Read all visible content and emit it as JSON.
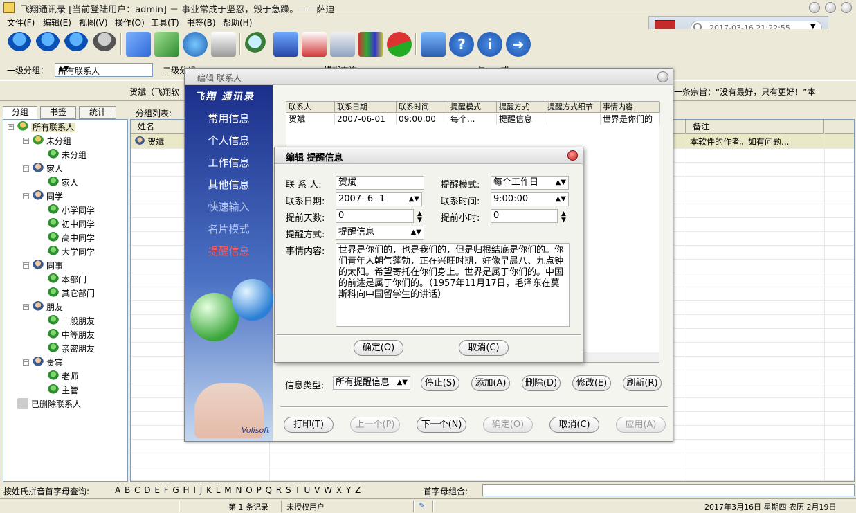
{
  "app": {
    "title": "飞翔通讯录  [当前登陆用户：admin]  －  事业常成于坚忍，毁于急躁。——萨迪"
  },
  "menu": [
    "文件(F)",
    "编辑(E)",
    "视图(V)",
    "操作(O)",
    "工具(T)",
    "书签(B)",
    "帮助(H)"
  ],
  "datetime": "2017-03-16 21:22:55",
  "filter": {
    "level1_label": "一级分组：",
    "level1_value": "所有联系人",
    "level2_label": "二级分组",
    "fuzzy_label": "模糊查询",
    "radio_and": "与",
    "radio_or": "或"
  },
  "marquee": {
    "left": "贺斌（飞翔软",
    "right": "的一条宗旨：“没有最好，只有更好！”本"
  },
  "left_tabs": [
    "分组",
    "书签",
    "统计"
  ],
  "tree": [
    {
      "label": "所有联系人",
      "level": 0
    },
    {
      "label": "未分组",
      "level": 1
    },
    {
      "label": "未分组",
      "level": 2
    },
    {
      "label": "家人",
      "level": 1
    },
    {
      "label": "家人",
      "level": 2
    },
    {
      "label": "同学",
      "level": 1
    },
    {
      "label": "小学同学",
      "level": 2
    },
    {
      "label": "初中同学",
      "level": 2
    },
    {
      "label": "高中同学",
      "level": 2
    },
    {
      "label": "大学同学",
      "level": 2
    },
    {
      "label": "同事",
      "level": 1
    },
    {
      "label": "本部门",
      "level": 2
    },
    {
      "label": "其它部门",
      "level": 2
    },
    {
      "label": "朋友",
      "level": 1
    },
    {
      "label": "一般朋友",
      "level": 2
    },
    {
      "label": "中等朋友",
      "level": 2
    },
    {
      "label": "亲密朋友",
      "level": 2
    },
    {
      "label": "贵宾",
      "level": 1
    },
    {
      "label": "老师",
      "level": 2
    },
    {
      "label": "主管",
      "level": 2
    },
    {
      "label": "已删除联系人",
      "level": 0
    }
  ],
  "grid": {
    "group_list_label": "分组列表:",
    "col_name": "姓名",
    "col_note": "备注",
    "row_name": "贺斌",
    "row_note": "本软件的作者。如有问题..."
  },
  "alpha": {
    "label": "按姓氏拼音首字母查询:",
    "letters": "A B C D E F G H I J K L M N O P Q R S T U V W X Y Z",
    "combo_label": "首字母组合:"
  },
  "status": {
    "records": "第 1 条记录",
    "license": "未授权用户",
    "date": "2017年3月16日  星期四  农历  2月19日"
  },
  "editor": {
    "title": "编辑  联系人",
    "brand": "飞翔 通讯录",
    "nav": [
      "常用信息",
      "个人信息",
      "工作信息",
      "其他信息",
      "快速输入",
      "名片模式",
      "提醒信息"
    ],
    "logo": "Volisoft",
    "columns": [
      "联系人",
      "联系日期",
      "联系时间",
      "提醒模式",
      "提醒方式",
      "提醒方式细节",
      "事情内容"
    ],
    "row": [
      "贺斌",
      "2007-06-01",
      "09:00:00",
      "每个...",
      "提醒信息",
      "",
      "世界是你们的"
    ],
    "info_type_label": "信息类型:",
    "info_type_value": "所有提醒信息",
    "btn_stop": "停止(S)",
    "btn_add": "添加(A)",
    "btn_delete": "删除(D)",
    "btn_modify": "修改(E)",
    "btn_refresh": "刷新(R)",
    "btn_print": "打印(T)",
    "btn_prev": "上一个(P)",
    "btn_next": "下一个(N)",
    "btn_ok": "确定(O)",
    "btn_cancel": "取消(C)",
    "btn_apply": "应用(A)"
  },
  "dialog": {
    "title": "编辑  提醒信息",
    "contact_label": "联 系 人:",
    "contact_value": "贺斌",
    "mode_label": "提醒模式:",
    "mode_value": "每个工作日",
    "date_label": "联系日期:",
    "date_value": "2007- 6- 1",
    "time_label": "联系时间:",
    "time_value": "9:00:00",
    "days_label": "提前天数:",
    "days_value": "0",
    "hours_label": "提前小时:",
    "hours_value": "0",
    "method_label": "提醒方式:",
    "method_value": "提醒信息",
    "content_label": "事情内容:",
    "content_value": "世界是你们的，也是我们的，但是归根结底是你们的。你们青年人朝气蓬勃，正在兴旺时期，好像早晨八、九点钟的太阳。希望寄托在你们身上。世界是属于你们的。中国的前途是属于你们的。（1957年11月17日，毛泽东在莫斯科向中国留学生的讲话）",
    "btn_ok": "确定(O)",
    "btn_cancel": "取消(C)"
  }
}
